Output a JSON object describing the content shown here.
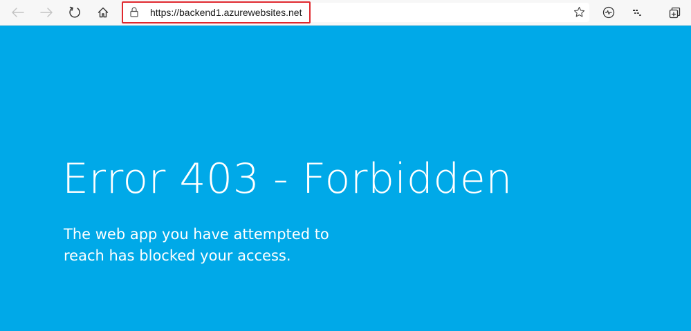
{
  "browser": {
    "address_bar": {
      "url": "https://backend1.azurewebsites.net"
    },
    "icons": {
      "back": "arrow-left-icon",
      "forward": "arrow-right-icon",
      "refresh": "refresh-icon",
      "home": "home-icon",
      "lock": "lock-icon",
      "favorite": "star-icon",
      "browser_essentials": "heartbeat-icon",
      "translate": "translate-icon",
      "collections": "collections-icon"
    },
    "colors": {
      "highlight_border": "#e0282e"
    }
  },
  "page": {
    "error_title": "Error 403 - Forbidden",
    "error_message": "The web app you have attempted to reach has blocked your access.",
    "background_color": "#00a9e8"
  }
}
